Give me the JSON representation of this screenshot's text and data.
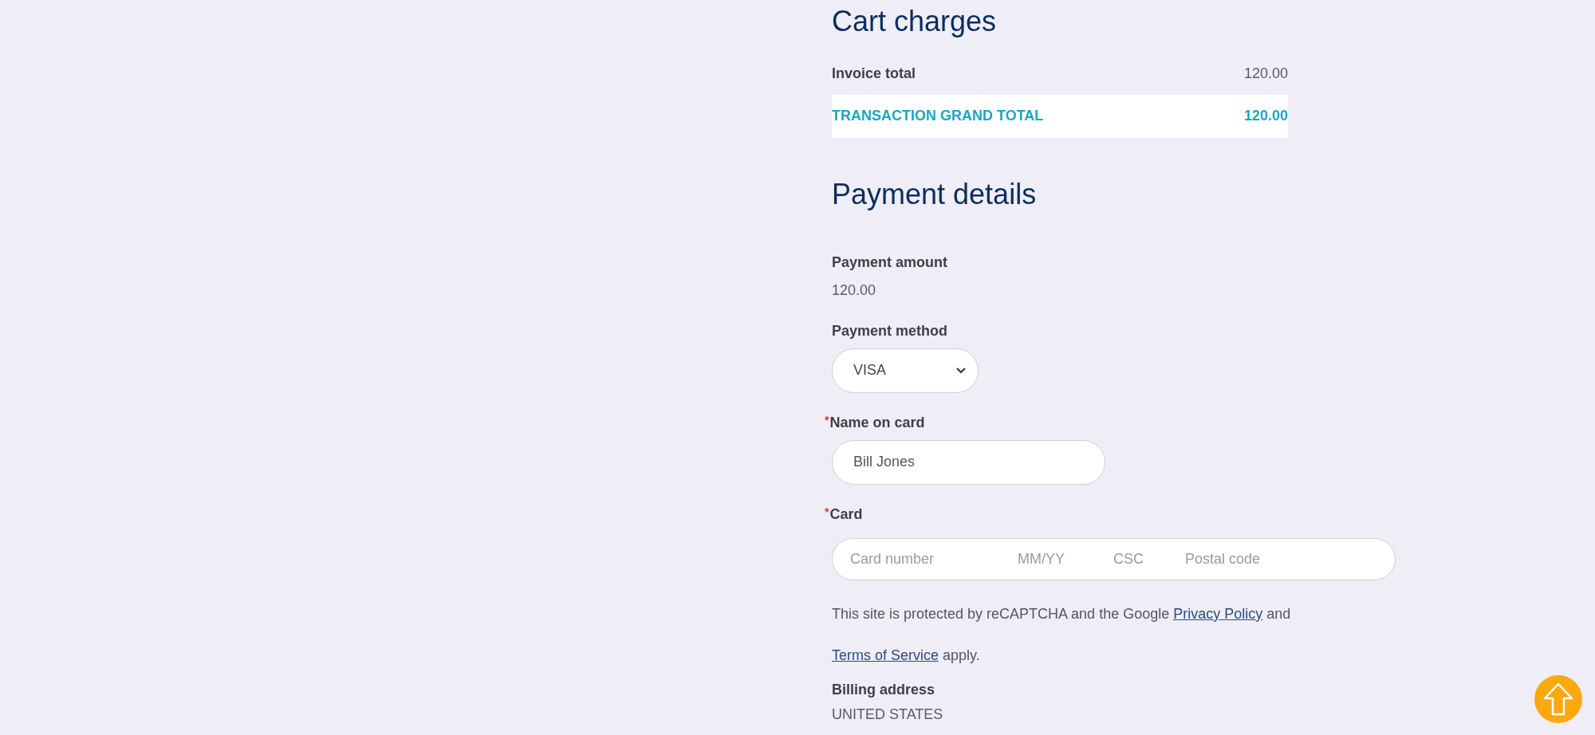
{
  "cart_charges": {
    "title": "Cart charges",
    "rows": [
      {
        "kind": "subtotal",
        "label": "Invoice total",
        "value": "120.00"
      },
      {
        "kind": "grand_total",
        "label": "TRANSACTION GRAND TOTAL",
        "value": "120.00"
      }
    ]
  },
  "payment_details": {
    "title": "Payment details",
    "amount": {
      "label": "Payment amount",
      "value": "120.00"
    },
    "method": {
      "label": "Payment method",
      "value": "VISA"
    },
    "name_on_card": {
      "label": "Name on card",
      "required_mark": "*",
      "value": "Bill Jones"
    },
    "card": {
      "label": "Card",
      "required_mark": "*",
      "placeholders": [
        "Card number",
        "MM/YY",
        "CSC",
        "Postal code"
      ]
    },
    "notice": [
      {
        "kind": "text",
        "text": "This site is protected by reCAPTCHA and the Google "
      },
      {
        "kind": "link",
        "text": "Privacy Policy"
      },
      {
        "kind": "text",
        "text": " and "
      },
      {
        "kind": "link",
        "text": "Terms of Service"
      },
      {
        "kind": "text",
        "text": " apply."
      }
    ],
    "billing": {
      "label": "Billing address",
      "value": "UNITED STATES"
    }
  }
}
